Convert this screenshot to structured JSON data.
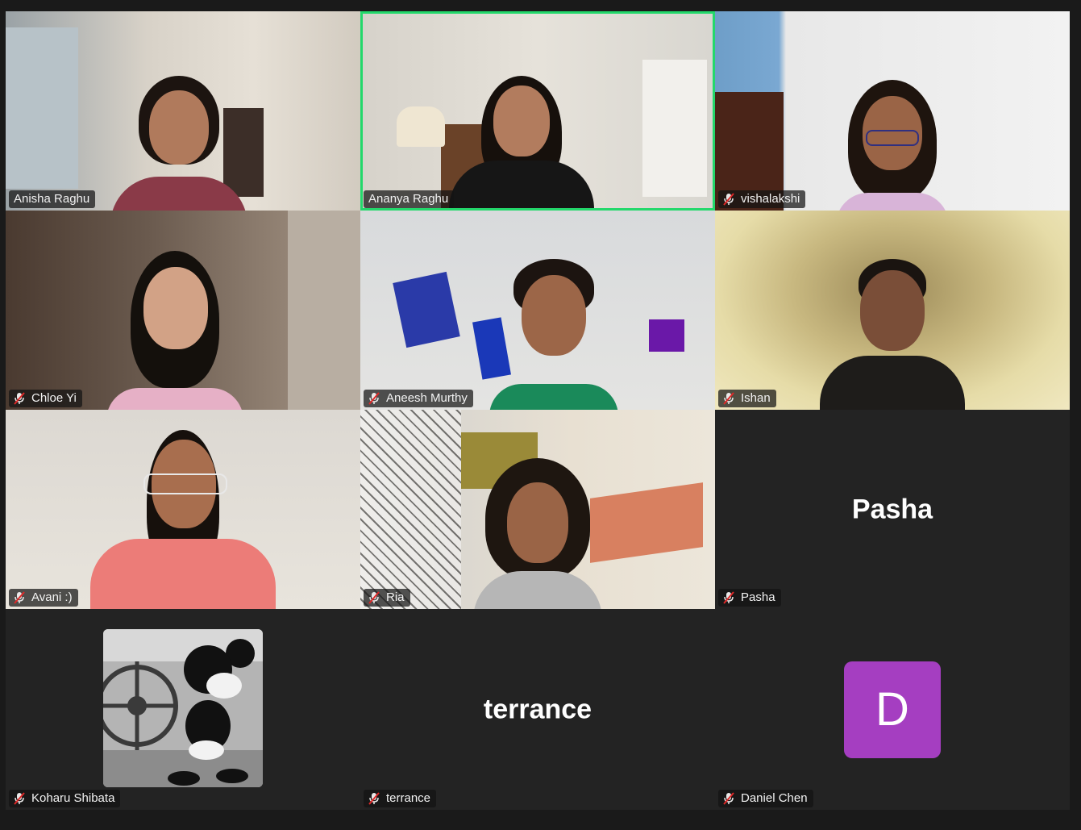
{
  "meeting": {
    "participants": [
      {
        "name": "Anisha Raghu",
        "muted": false,
        "active": false,
        "type": "video"
      },
      {
        "name": "Ananya Raghu",
        "muted": false,
        "active": true,
        "type": "video"
      },
      {
        "name": "vishalakshi",
        "muted": true,
        "active": false,
        "type": "video"
      },
      {
        "name": "Chloe Yi",
        "muted": true,
        "active": false,
        "type": "video"
      },
      {
        "name": "Aneesh Murthy",
        "muted": true,
        "active": false,
        "type": "video"
      },
      {
        "name": "Ishan",
        "muted": true,
        "active": false,
        "type": "video"
      },
      {
        "name": "Avani :)",
        "muted": true,
        "active": false,
        "type": "video"
      },
      {
        "name": "Ria",
        "muted": true,
        "active": false,
        "type": "video"
      },
      {
        "name": "Pasha",
        "muted": true,
        "active": false,
        "type": "name",
        "display_text": "Pasha"
      },
      {
        "name": "Koharu Shibata",
        "muted": true,
        "active": false,
        "type": "profile-picture"
      },
      {
        "name": "terrance",
        "muted": true,
        "active": false,
        "type": "name",
        "display_text": "terrance"
      },
      {
        "name": "Daniel Chen",
        "muted": true,
        "active": false,
        "type": "avatar",
        "avatar_letter": "D",
        "avatar_color": "#a53ec1"
      }
    ]
  },
  "colors": {
    "background": "#1a1a1a",
    "tile": "#232323",
    "active_speaker_border": "#23d86b",
    "muted_icon": "#e02828"
  },
  "icons": {
    "muted": "microphone-muted-icon"
  }
}
